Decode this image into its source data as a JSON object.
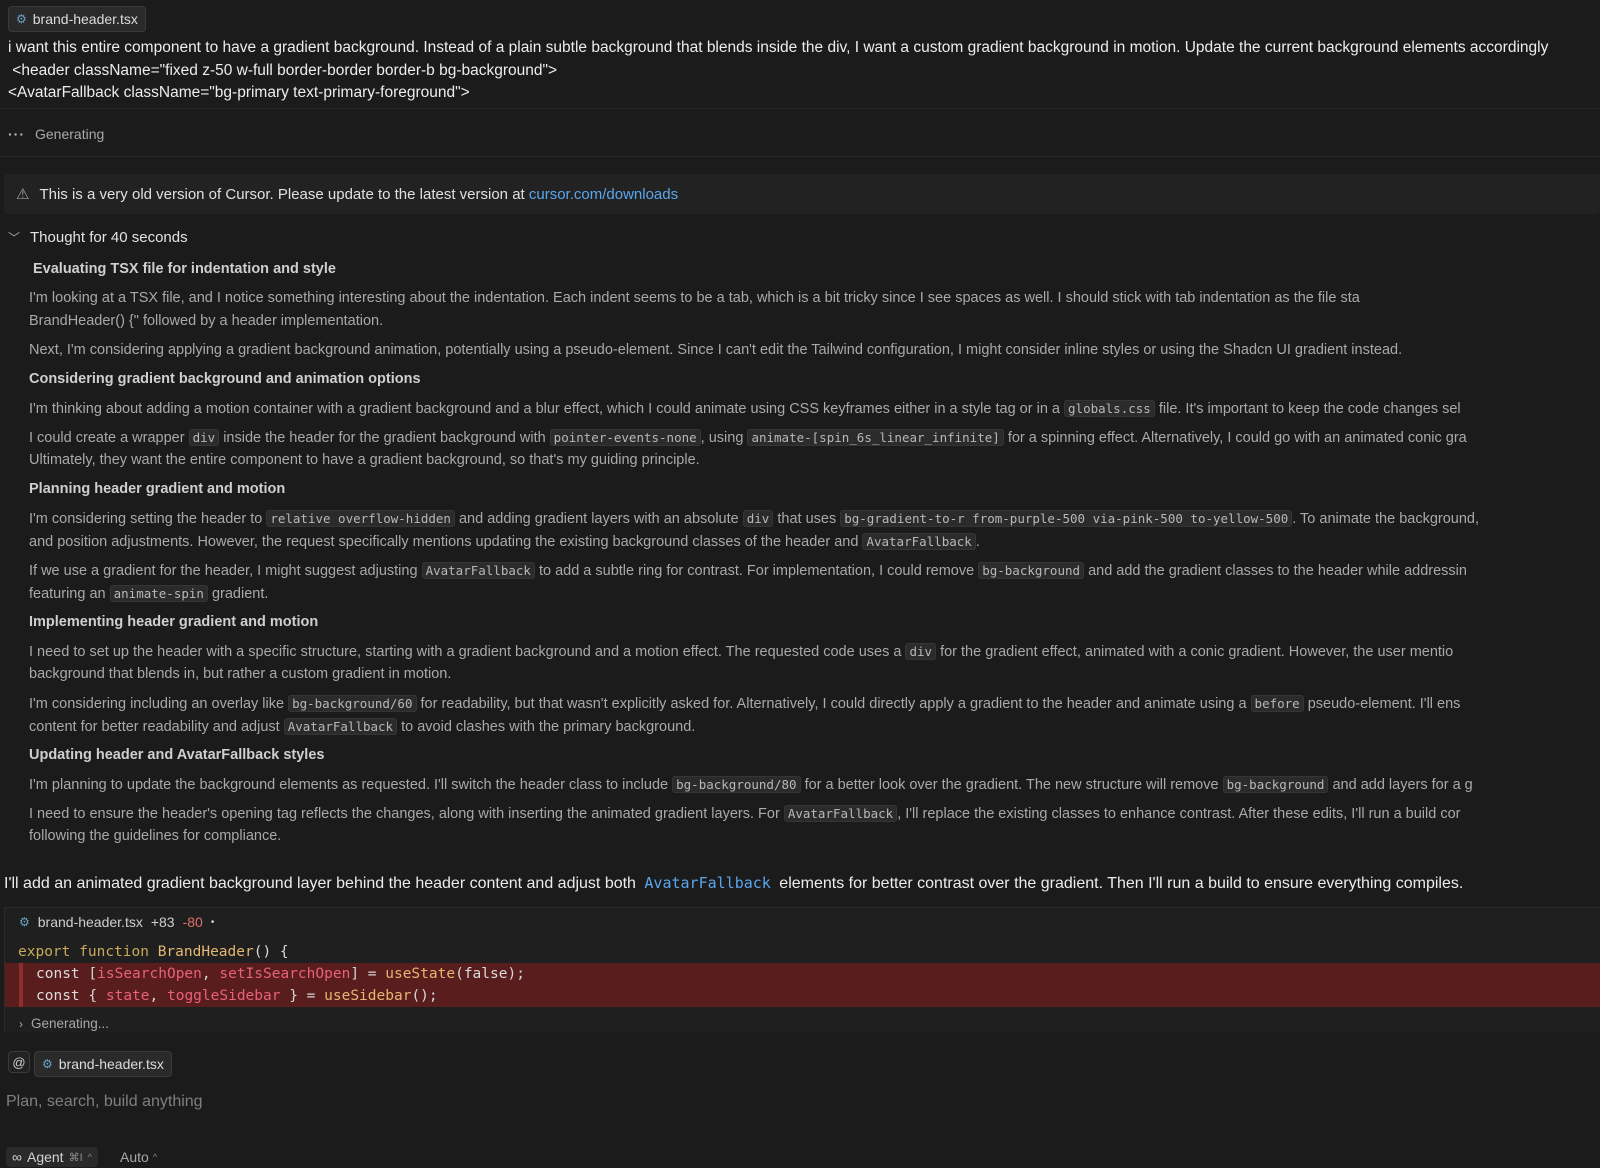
{
  "user": {
    "file_chip": "brand-header.tsx",
    "message_lines": [
      "i want this entire component to have a gradient background. Instead of a plain subtle background that blends inside the div, I want a custom gradient background in motion. Update the current background elements accordingly",
      " <header className=\"fixed z-50 w-full border-border border-b bg-background\">",
      "<AvatarFallback className=\"bg-primary text-primary-foreground\">"
    ]
  },
  "status": {
    "generating": "Generating"
  },
  "warning": {
    "text": "This is a very old version of Cursor. Please update to the latest version at ",
    "link": "cursor.com/downloads"
  },
  "thought": {
    "header": "Thought for 40 seconds",
    "h1": "Evaluating TSX file for indentation and style",
    "p1": [
      "I'm looking at a TSX file, and I notice something interesting about the indentation. Each indent seems to be a tab, which is a bit tricky since I see spaces as well. I should stick with tab indentation as the file sta",
      "BrandHeader() {\" followed by a header implementation."
    ],
    "p2": "Next, I'm considering applying a gradient background animation, potentially using a pseudo-element. Since I can't edit the Tailwind configuration, I might consider inline styles or using the Shadcn UI gradient instead.",
    "h2": "Considering gradient background and animation options",
    "p3": {
      "a": "I'm thinking about adding a motion container with a gradient background and a blur effect, which I could animate using CSS keyframes either in a style tag or in a",
      "c1": "globals.css",
      "b": "file. It's important to keep the code changes sel"
    },
    "p4": {
      "a": "I could create a wrapper",
      "c1": "div",
      "b": "inside the header for the gradient background with",
      "c2": "pointer-events-none",
      "c": ", using",
      "c3": "animate-[spin_6s_linear_infinite]",
      "d": "for a spinning effect. Alternatively, I could go with an animated conic gra",
      "line2": "Ultimately, they want the entire component to have a gradient background, so that's my guiding principle."
    },
    "h3": "Planning header gradient and motion",
    "p5": {
      "a": "I'm considering setting the header to",
      "c1": "relative overflow-hidden",
      "b": "and adding gradient layers with an absolute",
      "c2": "div",
      "c": "that uses",
      "c3": "bg-gradient-to-r from-purple-500 via-pink-500 to-yellow-500",
      "d": ". To animate the background,",
      "line2a": "and position adjustments. However, the request specifically mentions updating the existing background classes of the header and",
      "c4": "AvatarFallback",
      "line2b": "."
    },
    "p6": {
      "a": "If we use a gradient for the header, I might suggest adjusting",
      "c1": "AvatarFallback",
      "b": "to add a subtle ring for contrast. For implementation, I could remove",
      "c2": "bg-background",
      "c": "and add the gradient classes to the header while addressin",
      "line2a": "featuring an",
      "c3": "animate-spin",
      "line2b": "gradient."
    },
    "h4": "Implementing header gradient and motion",
    "p7": {
      "a": "I need to set up the header with a specific structure, starting with a gradient background and a motion effect. The requested code uses a",
      "c1": "div",
      "b": "for the gradient effect, animated with a conic gradient. However, the user mentio",
      "line2": "background that blends in, but rather a custom gradient in motion."
    },
    "p8": {
      "a": "I'm considering including an overlay like",
      "c1": "bg-background/60",
      "b": "for readability, but that wasn't explicitly asked for. Alternatively, I could directly apply a gradient to the header and animate using a",
      "c2": "before",
      "c": "pseudo-element. I'll ens",
      "line2a": "content for better readability and adjust",
      "c3": "AvatarFallback",
      "line2b": "to avoid clashes with the primary background."
    },
    "h5": "Updating header and AvatarFallback styles",
    "p9": {
      "a": "I'm planning to update the background elements as requested. I'll switch the header class to include",
      "c1": "bg-background/80",
      "b": "for a better look over the gradient. The new structure will remove",
      "c2": "bg-background",
      "c": "and add layers for a g"
    },
    "p10": {
      "a": "I need to ensure the header's opening tag reflects the changes, along with inserting the animated gradient layers. For",
      "c1": "AvatarFallback",
      "b": ", I'll replace the existing classes to enhance contrast. After these edits, I'll run a build cor",
      "line2": "following the guidelines for compliance."
    }
  },
  "assistant": {
    "a": "I'll add an animated gradient background layer behind the header content and adjust both",
    "code": "AvatarFallback",
    "b": "elements for better contrast over the gradient. Then I'll run a build to ensure everything compiles."
  },
  "diff": {
    "file": "brand-header.tsx",
    "added": "+83",
    "removed": "-80",
    "status_dot": "•",
    "line1": {
      "kw1": "export",
      "kw2": "function",
      "fn": "BrandHeader",
      "rest": "() {"
    },
    "line2": {
      "kw": "const",
      "p1": "[",
      "v1": "isSearchOpen",
      "p2": ", ",
      "v2": "setIsSearchOpen",
      "p3": "] = ",
      "call": "useState",
      "p4": "(",
      "lit": "false",
      "p5": ");"
    },
    "line3": {
      "kw": "const",
      "p1": "{ ",
      "v1": "state",
      "p2": ", ",
      "v2": "toggleSidebar",
      "p3": " } = ",
      "call": "useSidebar",
      "p4": "();"
    },
    "generating": "Generating..."
  },
  "composer": {
    "at": "@",
    "file_chip": "brand-header.tsx",
    "placeholder": "Plan, search, build anything",
    "agent_label": "Agent",
    "agent_shortcut": "⌘I",
    "model": "Auto"
  }
}
